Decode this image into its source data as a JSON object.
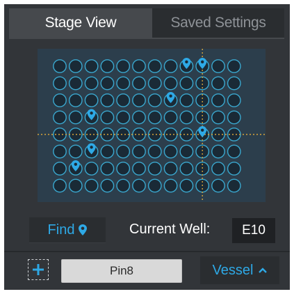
{
  "tabs": [
    {
      "label": "Stage View",
      "active": true
    },
    {
      "label": "Saved Settings",
      "active": false
    }
  ],
  "plate": {
    "rows": 8,
    "columns": 12,
    "markers": [
      {
        "row": 1,
        "col": 9
      },
      {
        "row": 1,
        "col": 10
      },
      {
        "row": 3,
        "col": 8
      },
      {
        "row": 4,
        "col": 3
      },
      {
        "row": 5,
        "col": 10
      },
      {
        "row": 6,
        "col": 3
      },
      {
        "row": 7,
        "col": 2
      }
    ],
    "crosshair": {
      "row": 5,
      "col": 10
    },
    "colors": {
      "well_stroke": "#3aa8cf",
      "well_fill": "#1a2a36",
      "marker": "#2ea9e6",
      "crosshair": "#d8a43a"
    }
  },
  "find": {
    "label": "Find",
    "icon": "map-pin-icon"
  },
  "current_well": {
    "label": "Current Well:",
    "value": "E10"
  },
  "bottom": {
    "add_icon": "plus-icon",
    "name_value": "Pin8",
    "vessel_label": "Vessel",
    "vessel_icon": "chevron-up-icon"
  },
  "colors": {
    "accent": "#2ea9e6",
    "panel_bg": "#323539"
  }
}
